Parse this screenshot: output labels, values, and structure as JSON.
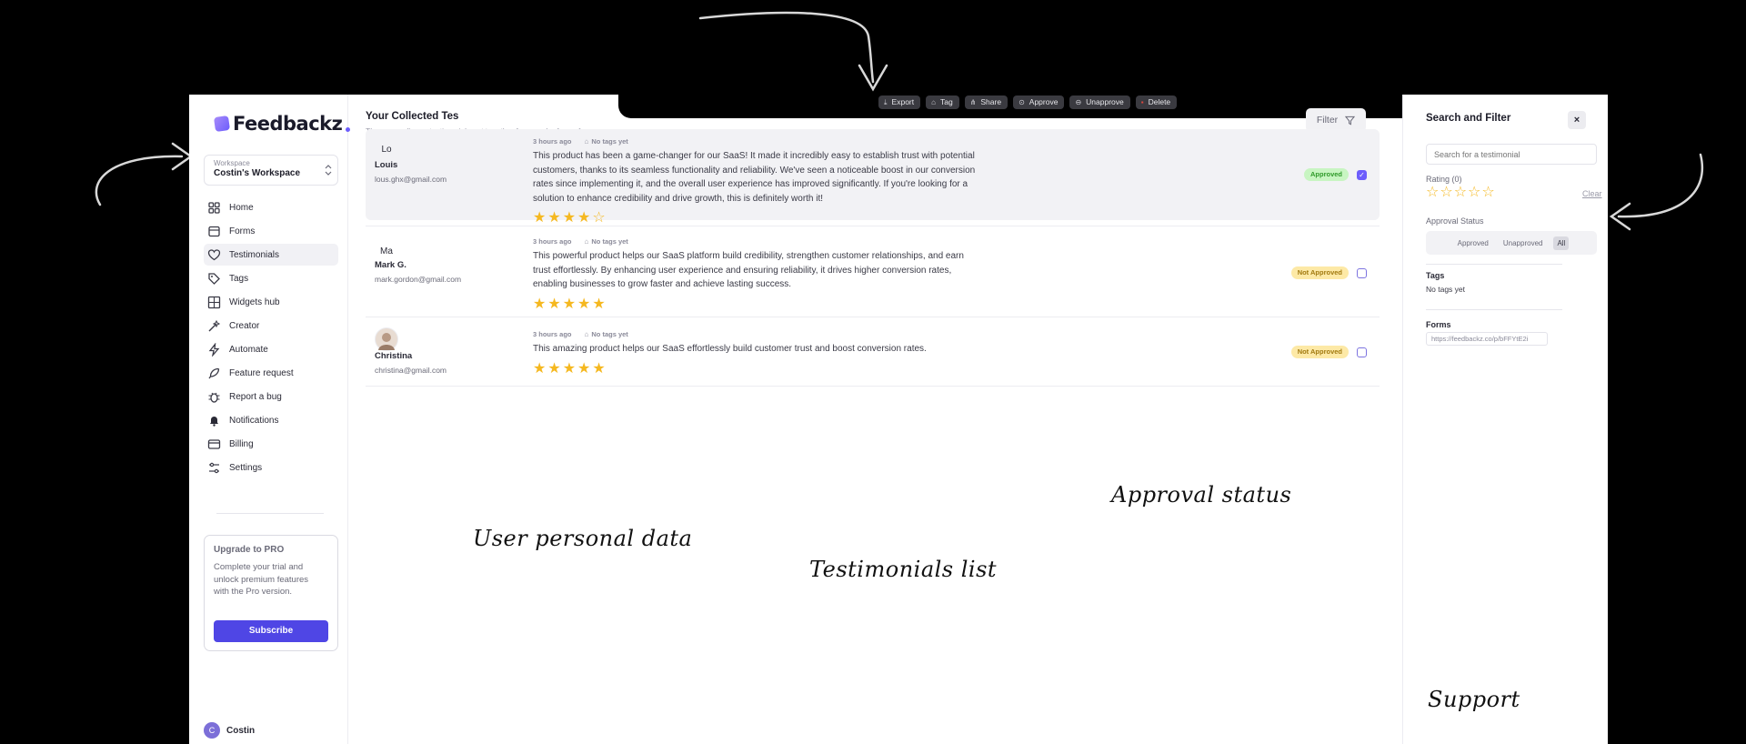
{
  "sidebar": {
    "brand": "Feedbackz",
    "workspace": {
      "label": "Workspace",
      "name": "Costin's Workspace"
    },
    "items": [
      {
        "label": "Home",
        "icon": "grid-icon",
        "active": false
      },
      {
        "label": "Forms",
        "icon": "form-icon",
        "active": false
      },
      {
        "label": "Testimonials",
        "icon": "heart-icon",
        "active": true
      },
      {
        "label": "Tags",
        "icon": "tag-icon",
        "active": false
      },
      {
        "label": "Widgets hub",
        "icon": "widgets-icon",
        "active": false
      },
      {
        "label": "Creator",
        "icon": "wand-icon",
        "active": false
      },
      {
        "label": "Automate",
        "icon": "bolt-icon",
        "active": false
      },
      {
        "label": "Feature request",
        "icon": "feather-icon",
        "active": false
      },
      {
        "label": "Report a bug",
        "icon": "bug-icon",
        "active": false
      },
      {
        "label": "Notifications",
        "icon": "bell-icon",
        "active": false
      },
      {
        "label": "Billing",
        "icon": "card-icon",
        "active": false
      },
      {
        "label": "Settings",
        "icon": "sliders-icon",
        "active": false
      }
    ],
    "upgrade": {
      "title": "Upgrade to PRO",
      "description": "Complete your trial and unlock premium features with the Pro version.",
      "button": "Subscribe"
    },
    "user": {
      "initial": "C",
      "name": "Costin"
    }
  },
  "main": {
    "title": "Your Collected Tes",
    "subtitle": "These are all your testimonials put together from each of your forms.",
    "filter_label": "Filter",
    "toolbar": {
      "export": "Export",
      "tag": "Tag",
      "share": "Share",
      "approve": "Approve",
      "unapprove": "Unapprove",
      "delete": "Delete"
    },
    "testimonials": [
      {
        "initials": "Lo",
        "name": "Louis",
        "email": "lous.ghx@gmail.com",
        "time": "3 hours ago",
        "tags": "No tags yet",
        "text": "This product has been a game-changer for our SaaS! It made it incredibly easy to establish trust with potential customers, thanks to its seamless functionality and reliability. We've seen a noticeable boost in our conversion rates since implementing it, and the overall user experience has improved significantly. If you're looking for a solution to enhance credibility and drive growth, this is definitely worth it!",
        "rating": 4,
        "status": "Approved",
        "selected": true
      },
      {
        "initials": "Ma",
        "name": "Mark G.",
        "email": "mark.gordon@gmail.com",
        "time": "3 hours ago",
        "tags": "No tags yet",
        "text": "This powerful product helps our SaaS platform build credibility, strengthen customer relationships, and earn trust effortlessly. By enhancing user experience and ensuring reliability, it drives higher conversion rates, enabling businesses to grow faster and achieve lasting success.",
        "rating": 5,
        "status": "Not Approved",
        "selected": false
      },
      {
        "initials": "",
        "name": "Christina",
        "email": "christina@gmail.com",
        "time": "3 hours ago",
        "tags": "No tags yet",
        "text": "This amazing product helps our SaaS effortlessly build customer trust and boost conversion rates.",
        "rating": 5,
        "status": "Not Approved",
        "selected": false
      }
    ]
  },
  "panel": {
    "title": "Search and Filter",
    "close": "×",
    "search_placeholder": "Search for a testimonial",
    "rating_label": "Rating (0)",
    "clear": "Clear",
    "approval_label": "Approval Status",
    "approval_options": [
      "Approved",
      "Unapproved",
      "All"
    ],
    "approval_selected": "All",
    "tags_label": "Tags",
    "tags_value": "No tags yet",
    "forms_label": "Forms",
    "forms_value": "https://feedbackz.co/p/bFFYtE2i"
  },
  "annotations": {
    "user_data": "User personal data",
    "list": "Testimonials list",
    "approval": "Approval status",
    "support": "Support"
  },
  "colors": {
    "accent": "#4f46e5",
    "star": "#f5b820",
    "approved_bg": "#c8f5c2",
    "not_approved_bg": "#fde9a6",
    "support": "#1a73d9"
  }
}
